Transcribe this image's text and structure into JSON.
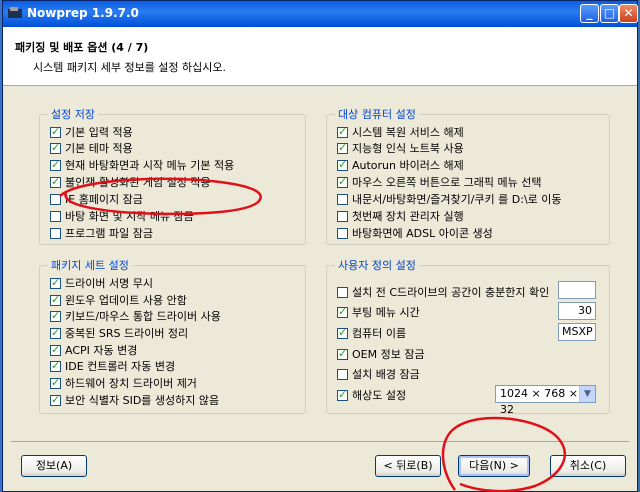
{
  "window": {
    "title": "Nowprep 1.9.7.0",
    "buttons": {
      "minimize": "_",
      "maximize": "□",
      "close": "✕"
    }
  },
  "header": {
    "title": "패키징 및 배포 옵션 (4 / 7)",
    "subtitle": "시스템 패키지 세부 정보를 설정 하십시오."
  },
  "groups": {
    "settings_save": {
      "legend": "설정 저장",
      "items": [
        {
          "label": "기본 입력 적용",
          "checked": true
        },
        {
          "label": "기본 테마 적용",
          "checked": true
        },
        {
          "label": "현재 바탕화면과 시작 메뉴 기본 적용",
          "checked": true
        },
        {
          "label": "불인잭 활성화된 게임 설정 적용",
          "checked": true
        },
        {
          "label": "IE 홈페이지 잠금",
          "checked": false
        },
        {
          "label": "바탕 화면 및 시작 메뉴 잠금",
          "checked": false
        },
        {
          "label": "프로그램 파일 잠금",
          "checked": false
        }
      ]
    },
    "target_computer": {
      "legend": "대상 컴퓨터 설정",
      "items": [
        {
          "label": "시스템 복원 서비스 해제",
          "checked": true
        },
        {
          "label": "지능형 인식 노트북 사용",
          "checked": true
        },
        {
          "label": "Autorun 바이러스 해제",
          "checked": true
        },
        {
          "label": "마우스 오른쪽 버튼으로 그래픽 메뉴 선택",
          "checked": true
        },
        {
          "label": "내문서/바탕화면/즐겨찾기/쿠키 를 D:\\로 이동",
          "checked": false
        },
        {
          "label": "첫번째 장치 관리자 실행",
          "checked": false
        },
        {
          "label": "바탕화면에 ADSL 아이콘 생성",
          "checked": false
        }
      ]
    },
    "package_set": {
      "legend": "패키지 세트 설정",
      "items": [
        {
          "label": "드라이버 서명 무시",
          "checked": true
        },
        {
          "label": "윈도우 업데이트 사용 안함",
          "checked": true
        },
        {
          "label": "키보드/마우스 통합 드라이버 사용",
          "checked": true
        },
        {
          "label": "중복된 SRS 드라이버 정리",
          "checked": true
        },
        {
          "label": "ACPI 자동 변경",
          "checked": true
        },
        {
          "label": "IDE 컨트롤러 자동 변경",
          "checked": true
        },
        {
          "label": "하드웨어 장치 드라이버 제거",
          "checked": true
        },
        {
          "label": "보안 식별자 SID를 생성하지 않음",
          "checked": true
        }
      ]
    },
    "user_defined": {
      "legend": "사용자 정의 설정",
      "items": [
        {
          "label": "설치 전 C드라이브의 공간이 충분한지 확인",
          "checked": false,
          "value": ""
        },
        {
          "label": "부팅 메뉴 시간",
          "checked": true,
          "value": "30"
        },
        {
          "label": "컴퓨터 이름",
          "checked": true,
          "value": "MSXP"
        },
        {
          "label": "OEM 정보 잠금",
          "checked": true
        },
        {
          "label": "설치 배경 잠금",
          "checked": false
        },
        {
          "label": "해상도 설정",
          "checked": true,
          "value": "1024 × 768 × 32"
        }
      ]
    }
  },
  "buttons": {
    "info": "정보(A)",
    "back": "< 뒤로(B)",
    "next": "다음(N) >",
    "cancel": "취소(C)"
  },
  "annotation_color": "#e0101a"
}
